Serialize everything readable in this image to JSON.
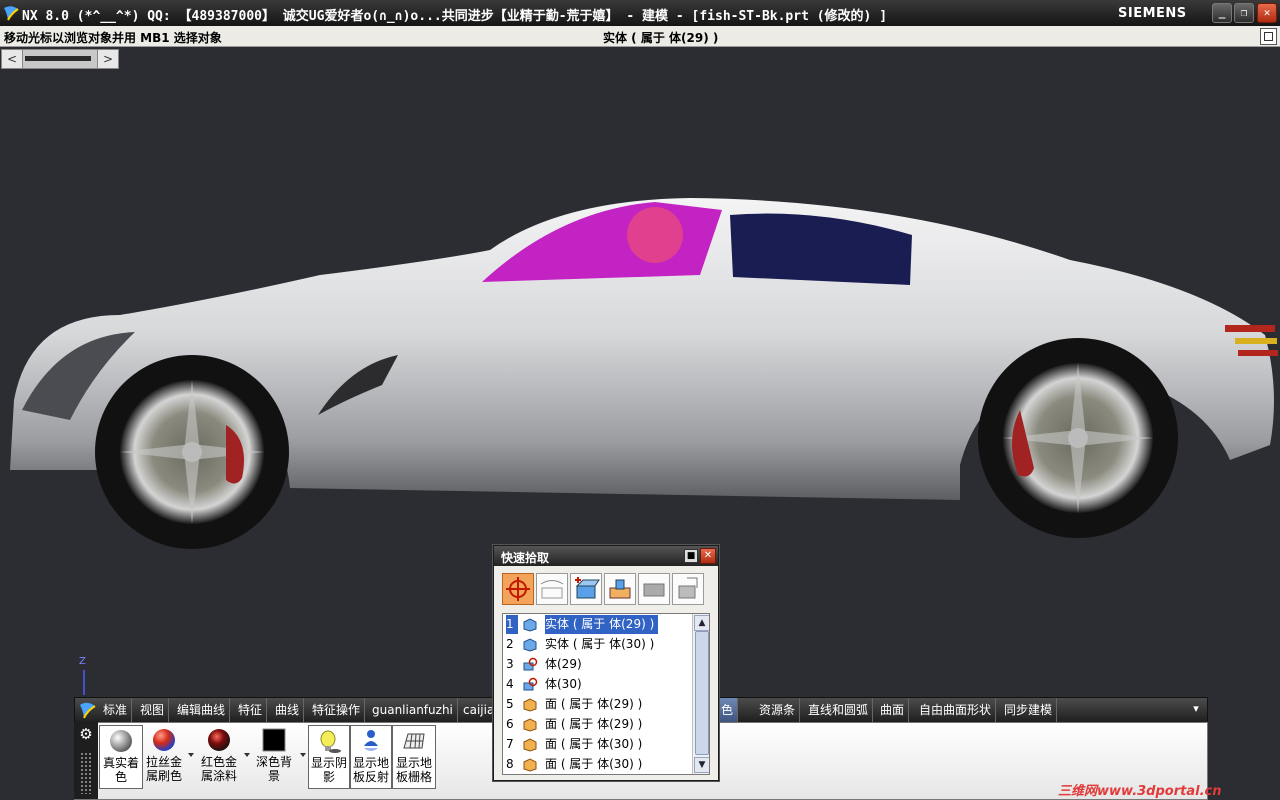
{
  "window": {
    "title": "NX 8.0 (*^__^*) QQ: 【489387000】 诚交UG爱好者o(∩_∩)o...共同进步【业精于勤-荒于嬉】 - 建模 - [fish-ST-Bk.prt  (修改的) ]",
    "brand": "SIEMENS",
    "minimize_label": "_",
    "restore_label": "❐",
    "close_label": "✕"
  },
  "status": {
    "prompt": "移动光标以浏览对象并用 MB1 选择对象",
    "selection": "实体 ( 属于 体(29) )"
  },
  "scroll": {
    "left_label": "<",
    "right_label": ">"
  },
  "viewport": {
    "axis_label": "Z",
    "car_color": "#d9dadc",
    "glass_color": "#cc22cc",
    "background": "#2b2d32"
  },
  "ribbon": {
    "tabs": [
      {
        "label": "标准"
      },
      {
        "label": "视图"
      },
      {
        "label": "编辑曲线"
      },
      {
        "label": "特征"
      },
      {
        "label": "曲线"
      },
      {
        "label": "特征操作"
      },
      {
        "label": "guanlianfuzhi"
      },
      {
        "label": "caijia"
      },
      {
        "label": "着色"
      },
      {
        "label": "资源条"
      },
      {
        "label": "直线和圆弧"
      },
      {
        "label": "曲面"
      },
      {
        "label": "自由曲面形状"
      },
      {
        "label": "同步建模"
      }
    ],
    "active_tab": "着色",
    "menu_label": "▾",
    "gear_label": "⚙",
    "buttons": [
      {
        "label": "真实着色",
        "icon": "sphere-icon"
      },
      {
        "label": "拉丝金属刷色",
        "icon": "red-sphere-icon"
      },
      {
        "label": "红色金属涂料",
        "icon": "dark-red-sphere-icon"
      },
      {
        "label": "深色背景",
        "icon": "black-square-icon"
      },
      {
        "label": "显示阴影",
        "icon": "light-bulb-icon"
      },
      {
        "label": "显示地板反射",
        "icon": "person-reflection-icon"
      },
      {
        "label": "显示地板栅格",
        "icon": "grid-icon"
      }
    ]
  },
  "quick_pick": {
    "title": "快速拾取",
    "pin_label": "■",
    "close_label": "✕",
    "filters": [
      "crosshair-icon",
      "curve-icon",
      "add-body-icon",
      "feature-icon",
      "face-icon",
      "edge-icon"
    ],
    "items": [
      {
        "num": "1",
        "text": "实体 ( 属于 体(29) )",
        "icon": "solid-body-icon",
        "selected": true
      },
      {
        "num": "2",
        "text": "实体 ( 属于 体(30) )",
        "icon": "solid-body-icon",
        "selected": false
      },
      {
        "num": "3",
        "text": "体(29)",
        "icon": "body-feature-icon",
        "selected": false
      },
      {
        "num": "4",
        "text": "体(30)",
        "icon": "body-feature-icon",
        "selected": false
      },
      {
        "num": "5",
        "text": "面 ( 属于 体(29) )",
        "icon": "face-icon",
        "selected": false
      },
      {
        "num": "6",
        "text": "面 ( 属于 体(29) )",
        "icon": "face-icon",
        "selected": false
      },
      {
        "num": "7",
        "text": "面 ( 属于 体(30) )",
        "icon": "face-icon",
        "selected": false
      },
      {
        "num": "8",
        "text": "面 ( 属于 体(30) )",
        "icon": "face-icon",
        "selected": false
      }
    ],
    "scroll_up": "▲",
    "scroll_down": "▼"
  },
  "watermark": "三维网www.3dportal.cn"
}
